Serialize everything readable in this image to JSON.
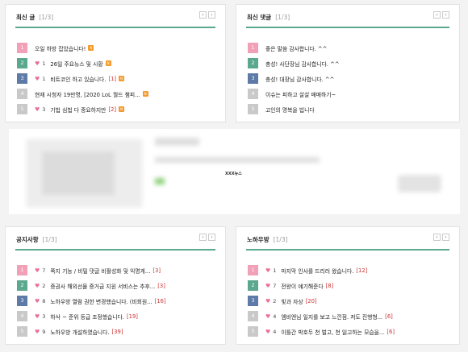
{
  "colors": {
    "rank1": "#f2a0b7",
    "rank2": "#5aa88e",
    "rank3": "#5e7aa8",
    "rank_other": "#c9c9c9",
    "accent_line": "#5aa88e",
    "heart": "#ea6f94",
    "comment_count": "#cc3333",
    "new_badge": "#f39b2f"
  },
  "icons": {
    "heart": "heart-icon",
    "new": "new-badge-icon",
    "prev": "chevron-left-icon",
    "next": "chevron-right-icon"
  },
  "pager": {
    "prev": "‹",
    "next": "›"
  },
  "widgets": {
    "latest_posts": {
      "title": "최신 글",
      "page": "[1/3]",
      "rows": [
        {
          "rank": "1",
          "text": "오일 하방 잡았습니다!",
          "new": "N"
        },
        {
          "rank": "2",
          "likes": "1",
          "text": "26일 주요뉴스 및 시황",
          "new": "N"
        },
        {
          "rank": "3",
          "likes": "1",
          "text": "비트코인 하고 있습니다.",
          "comments": "[1]",
          "new": "N"
        },
        {
          "rank": "4",
          "text": "현재 시청자 19만명, [2020 LoL 월드 챔피...",
          "new": "N"
        },
        {
          "rank": "5",
          "likes": "3",
          "text": "기법 심법 다 중요하지만",
          "comments": "[2]",
          "new": "N"
        }
      ]
    },
    "latest_comments": {
      "title": "최신 댓글",
      "page": "[1/3]",
      "rows": [
        {
          "rank": "1",
          "text": "좋은 말씀 감사합니다. ^^"
        },
        {
          "rank": "2",
          "text": "충성! 사단장님 감사합니다. ^^"
        },
        {
          "rank": "3",
          "text": "충성! 대장님 감사합니다. ^^"
        },
        {
          "rank": "4",
          "text": "이슈는 피하고 살살 매매하기~"
        },
        {
          "rank": "5",
          "text": "고인의 명복을 빕니다"
        }
      ]
    },
    "notices": {
      "title": "공지사항",
      "page": "[1/3]",
      "rows": [
        {
          "rank": "1",
          "likes": "7",
          "text": "쪽지 기능 / 비밀 댓글 비활성화 및 익명게...",
          "comments": "[3]"
        },
        {
          "rank": "2",
          "likes": "2",
          "text": "증권사 해외선물 증거금 지원 서비스는 추후...",
          "comments": "[3]"
        },
        {
          "rank": "3",
          "likes": "8",
          "text": "노하우방 열람 권한 변경했습니다. (비회원...",
          "comments": "[16]"
        },
        {
          "rank": "4",
          "likes": "3",
          "text": "하삭 ~ 준위 등급 조정했습니다.",
          "comments": "[19]"
        },
        {
          "rank": "5",
          "likes": "9",
          "text": "노하우방 개설하였습니다.",
          "comments": "[39]"
        }
      ]
    },
    "knowhow": {
      "title": "노하우방",
      "page": "[1/3]",
      "rows": [
        {
          "rank": "1",
          "likes": "1",
          "text": "마지막 인사를 드리러 왔습니다.",
          "comments": "[12]"
        },
        {
          "rank": "2",
          "likes": "7",
          "text": "전왕이 얘기해준다",
          "comments": "[8]"
        },
        {
          "rank": "3",
          "likes": "2",
          "text": "빛과 자상",
          "comments": "[20]"
        },
        {
          "rank": "4",
          "likes": "4",
          "text": "엠비엔님 일지를 보고 느낀점. 저도 진행형...",
          "comments": "[6]"
        },
        {
          "rank": "5",
          "likes": "4",
          "text": "이틀간 박호두 천 벌고, 천 잃고하는 모습을...",
          "comments": "[6]"
        }
      ]
    }
  },
  "ad": {
    "label": "XXX뉴스"
  }
}
